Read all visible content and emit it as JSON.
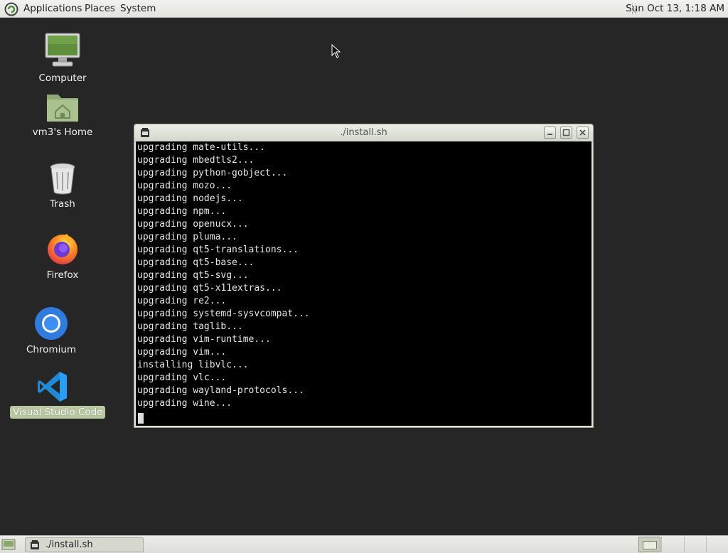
{
  "top_panel": {
    "menus": {
      "applications": "Applications",
      "places": "Places",
      "system": "System"
    },
    "clock": "Sun Oct 13,  1:18 AM"
  },
  "desktop": {
    "icons": [
      {
        "label": "Computer",
        "icon": "computer-icon"
      },
      {
        "label": "vm3's Home",
        "icon": "home-folder-icon"
      },
      {
        "label": "Trash",
        "icon": "trash-icon"
      },
      {
        "label": "Firefox",
        "icon": "firefox-icon"
      },
      {
        "label": "Chromium",
        "icon": "chromium-icon"
      },
      {
        "label": "Visual Studio Code",
        "icon": "vscode-icon",
        "selected": true
      }
    ]
  },
  "terminal": {
    "title": "./install.sh",
    "lines": [
      "upgrading mate-utils...",
      "upgrading mbedtls2...",
      "upgrading python-gobject...",
      "upgrading mozo...",
      "upgrading nodejs...",
      "upgrading npm...",
      "upgrading openucx...",
      "upgrading pluma...",
      "upgrading qt5-translations...",
      "upgrading qt5-base...",
      "upgrading qt5-svg...",
      "upgrading qt5-x11extras...",
      "upgrading re2...",
      "upgrading systemd-sysvcompat...",
      "upgrading taglib...",
      "upgrading vim-runtime...",
      "upgrading vim...",
      "installing libvlc...",
      "upgrading vlc...",
      "upgrading wayland-protocols...",
      "upgrading wine..."
    ]
  },
  "bottom_panel": {
    "tasks": [
      {
        "label": "./install.sh",
        "icon": "terminal-icon"
      }
    ],
    "workspaces": 4
  },
  "colors": {
    "desktop_bg": "#262626",
    "selection_bg": "#b7c79e",
    "terminal_bg": "#000000",
    "terminal_fg": "#e6e6e6"
  }
}
